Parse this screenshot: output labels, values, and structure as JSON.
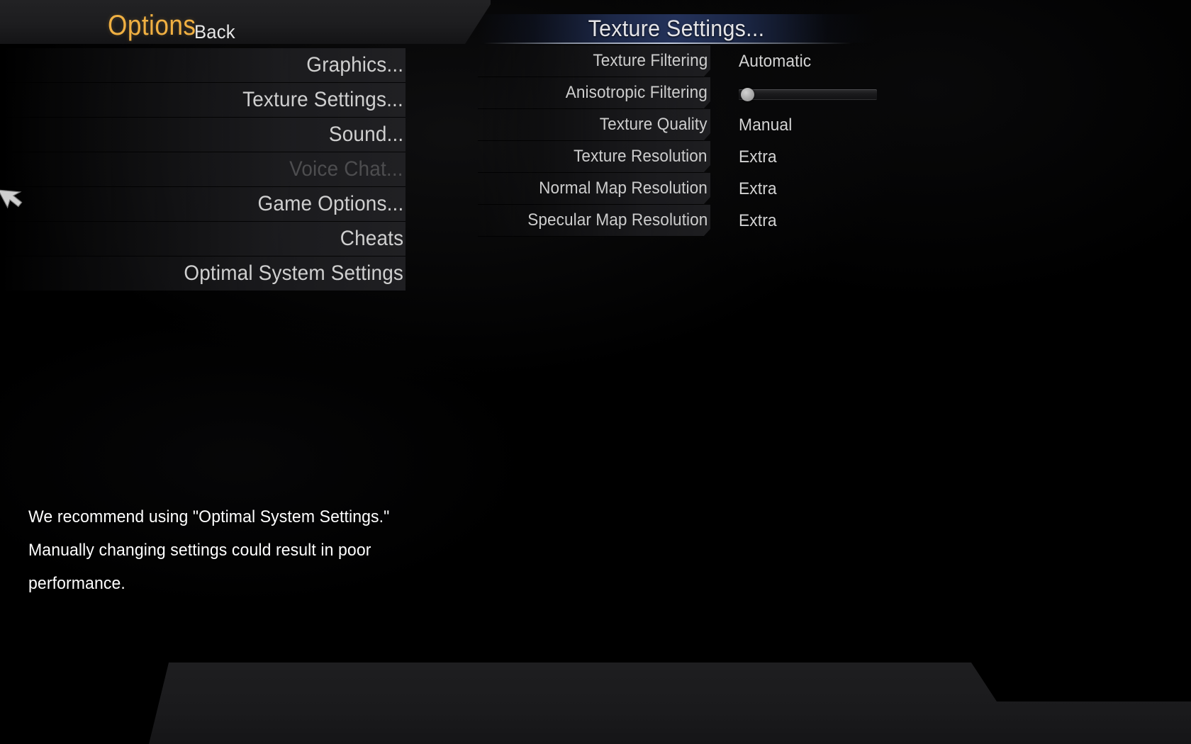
{
  "header": {
    "title": "Options"
  },
  "sidebar": {
    "items": [
      {
        "label": "Graphics...",
        "disabled": false
      },
      {
        "label": "Texture Settings...",
        "disabled": false
      },
      {
        "label": "Sound...",
        "disabled": false
      },
      {
        "label": "Voice Chat...",
        "disabled": true
      },
      {
        "label": "Game Options...",
        "disabled": false
      },
      {
        "label": "Cheats",
        "disabled": false
      },
      {
        "label": "Optimal System Settings",
        "disabled": false
      }
    ]
  },
  "panel": {
    "title": "Texture Settings...",
    "rows": [
      {
        "label": "Texture Filtering",
        "value": "Automatic",
        "type": "value"
      },
      {
        "label": "Anisotropic Filtering",
        "value": "",
        "type": "slider",
        "slider_percent": 0
      },
      {
        "label": "Texture Quality",
        "value": "Manual",
        "type": "value"
      },
      {
        "label": "Texture Resolution",
        "value": "Extra",
        "type": "value"
      },
      {
        "label": "Normal Map Resolution",
        "value": "Extra",
        "type": "value"
      },
      {
        "label": "Specular Map Resolution",
        "value": "Extra",
        "type": "value"
      }
    ]
  },
  "recommendation": {
    "text": "We recommend using \"Optimal System Settings.\"  Manually changing settings could result in poor performance."
  },
  "footer": {
    "back_label": "Back"
  },
  "colors": {
    "title_accent": "#f0b042",
    "panel_highlight": "#24325a",
    "text_primary": "#d8d8d8",
    "text_disabled": "#4d4d4f"
  },
  "cursor": {
    "icon": "arrow-cursor-icon"
  }
}
